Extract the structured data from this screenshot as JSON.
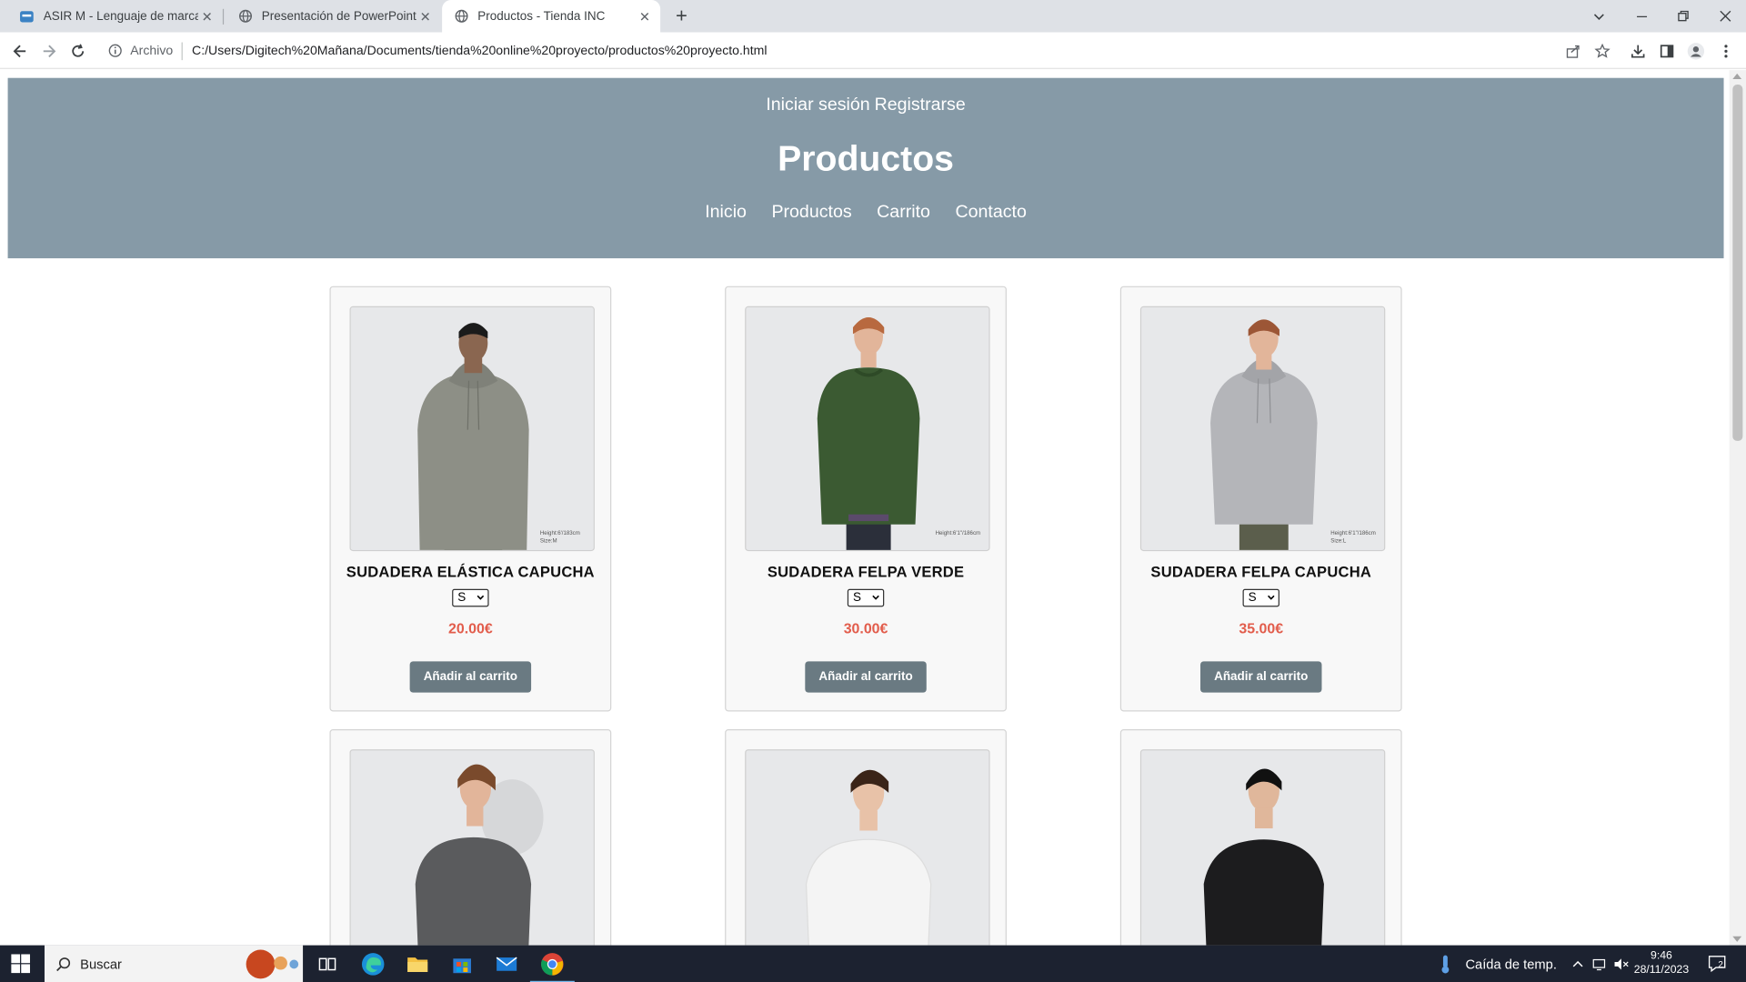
{
  "browser": {
    "tabs": [
      {
        "title": "ASIR M - Lenguaje de marcas y ...",
        "active": false
      },
      {
        "title": "Presentación de PowerPoint",
        "active": false
      },
      {
        "title": "Productos - Tienda INC",
        "active": true
      }
    ],
    "address": {
      "scheme_label": "Archivo",
      "url": "C:/Users/Digitech%20Mañana/Documents/tienda%20online%20proyecto/productos%20proyecto.html"
    }
  },
  "header": {
    "login": "Iniciar sesión",
    "register": "Registrarse",
    "title": "Productos",
    "nav": [
      "Inicio",
      "Productos",
      "Carrito",
      "Contacto"
    ]
  },
  "products": [
    {
      "name": "SUDADERA ELÁSTICA CAPUCHA",
      "size": "S",
      "price": "20.00€",
      "button": "Añadir al carrito",
      "garment_color": "#8d8f86",
      "photo_caption": "Height:6'/183cm\nSize:M"
    },
    {
      "name": "SUDADERA FELPA VERDE",
      "size": "S",
      "price": "30.00€",
      "button": "Añadir al carrito",
      "garment_color": "#3b5a32",
      "photo_caption": "Height:6'1\"/186cm"
    },
    {
      "name": "SUDADERA FELPA CAPUCHA",
      "size": "S",
      "price": "35.00€",
      "button": "Añadir al carrito",
      "garment_color": "#b4b5b9",
      "photo_caption": "Height:6'1\"/186cm\nSize:L"
    },
    {
      "name": "",
      "size": "",
      "price": "",
      "button": "",
      "garment_color": "#5a5b5d"
    },
    {
      "name": "",
      "size": "",
      "price": "",
      "button": "",
      "garment_color": "#f4f4f4"
    },
    {
      "name": "",
      "size": "",
      "price": "",
      "button": "",
      "garment_color": "#1c1c1e"
    }
  ],
  "taskbar": {
    "search_placeholder": "Buscar",
    "weather": "Caída de temp.",
    "time": "9:46",
    "date": "28/11/2023",
    "notifications": "2"
  },
  "colors": {
    "header_bg": "#869aa7",
    "price": "#e25c4b",
    "button_bg": "#6a7a82"
  }
}
